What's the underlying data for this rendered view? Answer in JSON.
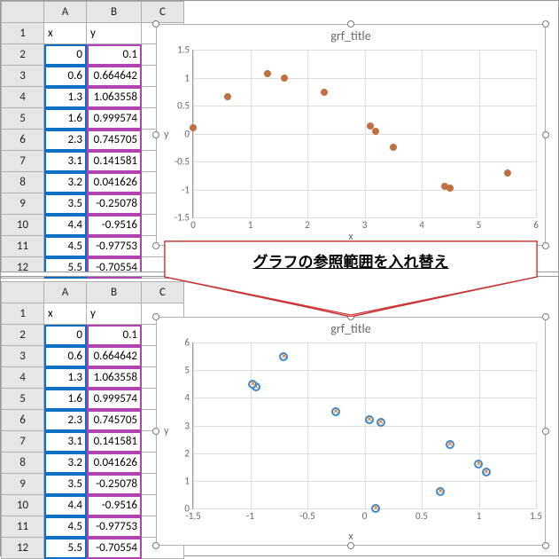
{
  "columns": [
    "A",
    "B",
    "C"
  ],
  "header": {
    "x": "x",
    "y": "y"
  },
  "rows": [
    {
      "x": "0",
      "y": "0.1"
    },
    {
      "x": "0.6",
      "y": "0.664642"
    },
    {
      "x": "1.3",
      "y": "1.063558"
    },
    {
      "x": "1.6",
      "y": "0.999574"
    },
    {
      "x": "2.3",
      "y": "0.745705"
    },
    {
      "x": "3.1",
      "y": "0.141581"
    },
    {
      "x": "3.2",
      "y": "0.041626"
    },
    {
      "x": "3.5",
      "y": "-0.25078"
    },
    {
      "x": "4.4",
      "y": "-0.9516"
    },
    {
      "x": "4.5",
      "y": "-0.97753"
    },
    {
      "x": "5.5",
      "y": "-0.70554"
    }
  ],
  "annotation": "グラフの参照範囲を入れ替え",
  "chart_data": [
    {
      "type": "scatter",
      "title": "grf_title",
      "xlabel": "x",
      "ylabel": "y",
      "xlim": [
        0,
        6
      ],
      "ylim": [
        -1.5,
        1.5
      ],
      "xticks": [
        0,
        1,
        2,
        3,
        4,
        5,
        6
      ],
      "yticks": [
        -1.5,
        -1,
        -0.5,
        0,
        0.5,
        1,
        1.5
      ],
      "series": [
        {
          "name": "y",
          "x": [
            0,
            0.6,
            1.3,
            1.6,
            2.3,
            3.1,
            3.2,
            3.5,
            4.4,
            4.5,
            5.5
          ],
          "y": [
            0.1,
            0.664642,
            1.063558,
            0.999574,
            0.745705,
            0.141581,
            0.041626,
            -0.25078,
            -0.9516,
            -0.97753,
            -0.70554
          ]
        }
      ]
    },
    {
      "type": "scatter",
      "title": "grf_title",
      "xlabel": "x",
      "ylabel": "y",
      "xlim": [
        -1.5,
        1.5
      ],
      "ylim": [
        0,
        6
      ],
      "xticks": [
        -1.5,
        -1,
        -0.5,
        0,
        0.5,
        1,
        1.5
      ],
      "yticks": [
        0,
        1,
        2,
        3,
        4,
        5,
        6
      ],
      "series": [
        {
          "name": "x",
          "x": [
            0.1,
            0.664642,
            1.063558,
            0.999574,
            0.745705,
            0.141581,
            0.041626,
            -0.25078,
            -0.9516,
            -0.97753,
            -0.70554
          ],
          "y": [
            0,
            0.6,
            1.3,
            1.6,
            2.3,
            3.1,
            3.2,
            3.5,
            4.4,
            4.5,
            5.5
          ]
        }
      ]
    }
  ]
}
